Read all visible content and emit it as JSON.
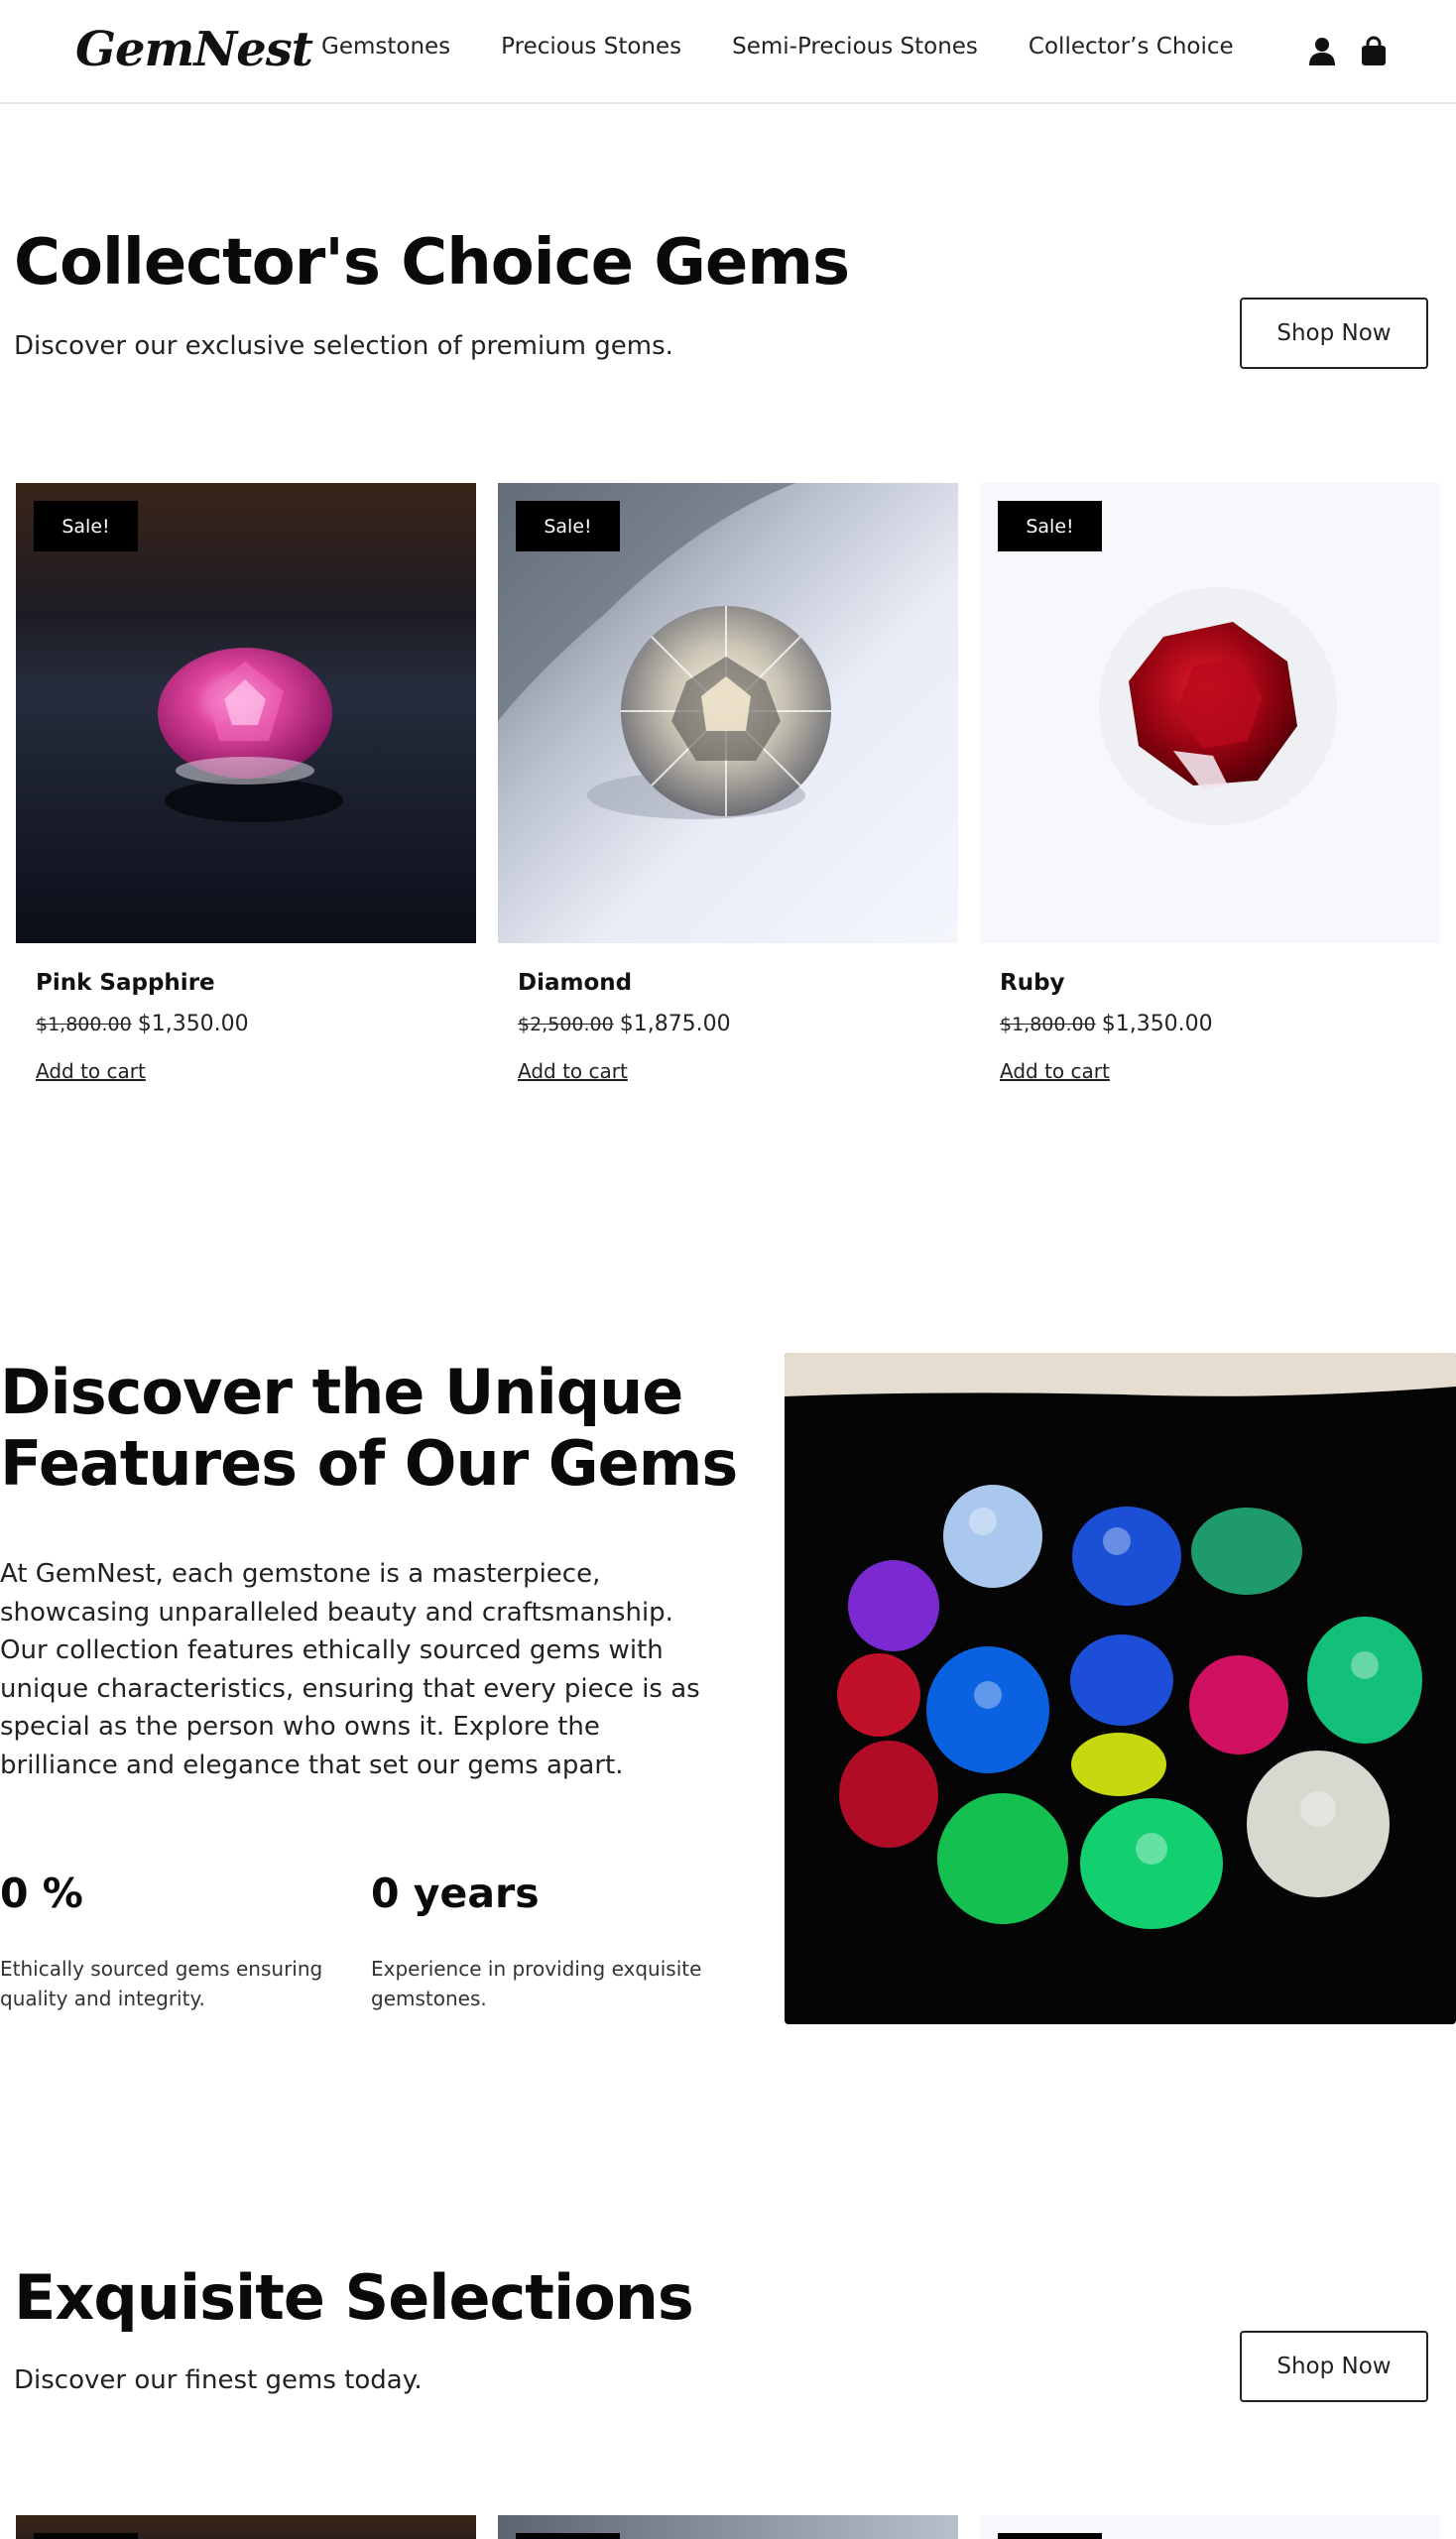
{
  "brand": {
    "logo": "GemNest"
  },
  "nav": {
    "items": [
      "Gemstones",
      "Precious Stones",
      "Semi-Precious Stones",
      "Collector’s Choice"
    ],
    "account_icon": "user-icon",
    "cart_icon": "shopping-bag-icon"
  },
  "collectors": {
    "title": "Collector's Choice Gems",
    "subtitle": "Discover our exclusive selection of premium gems.",
    "shop_now": "Shop Now",
    "products": [
      {
        "badge": "Sale!",
        "name": "Pink Sapphire",
        "old_price": "$1,800.00",
        "price": "$1,350.00",
        "cta": "Add to cart"
      },
      {
        "badge": "Sale!",
        "name": "Diamond",
        "old_price": "$2,500.00",
        "price": "$1,875.00",
        "cta": "Add to cart"
      },
      {
        "badge": "Sale!",
        "name": "Ruby",
        "old_price": "$1,800.00",
        "price": "$1,350.00",
        "cta": "Add to cart"
      }
    ]
  },
  "features": {
    "title_line1": "Discover the Unique",
    "title_line2": "Features of Our Gems",
    "body": "At GemNest, each gemstone is a masterpiece, showcasing unparalleled beauty and craftsmanship. Our collection features ethically sourced gems with unique characteristics, ensuring that every piece is as special as the person who owns it. Explore the brilliance and elegance that set our gems apart.",
    "stats": [
      {
        "value": "0 %",
        "desc": "Ethically sourced gems ensuring quality and integrity."
      },
      {
        "value": "0 years",
        "desc": "Experience in providing exquisite gemstones."
      }
    ]
  },
  "exquisite": {
    "title": "Exquisite Selections",
    "subtitle": "Discover our finest gems today.",
    "shop_now": "Shop Now"
  },
  "colors": {
    "accent": "#000000",
    "text": "#111111",
    "border": "#222222"
  }
}
